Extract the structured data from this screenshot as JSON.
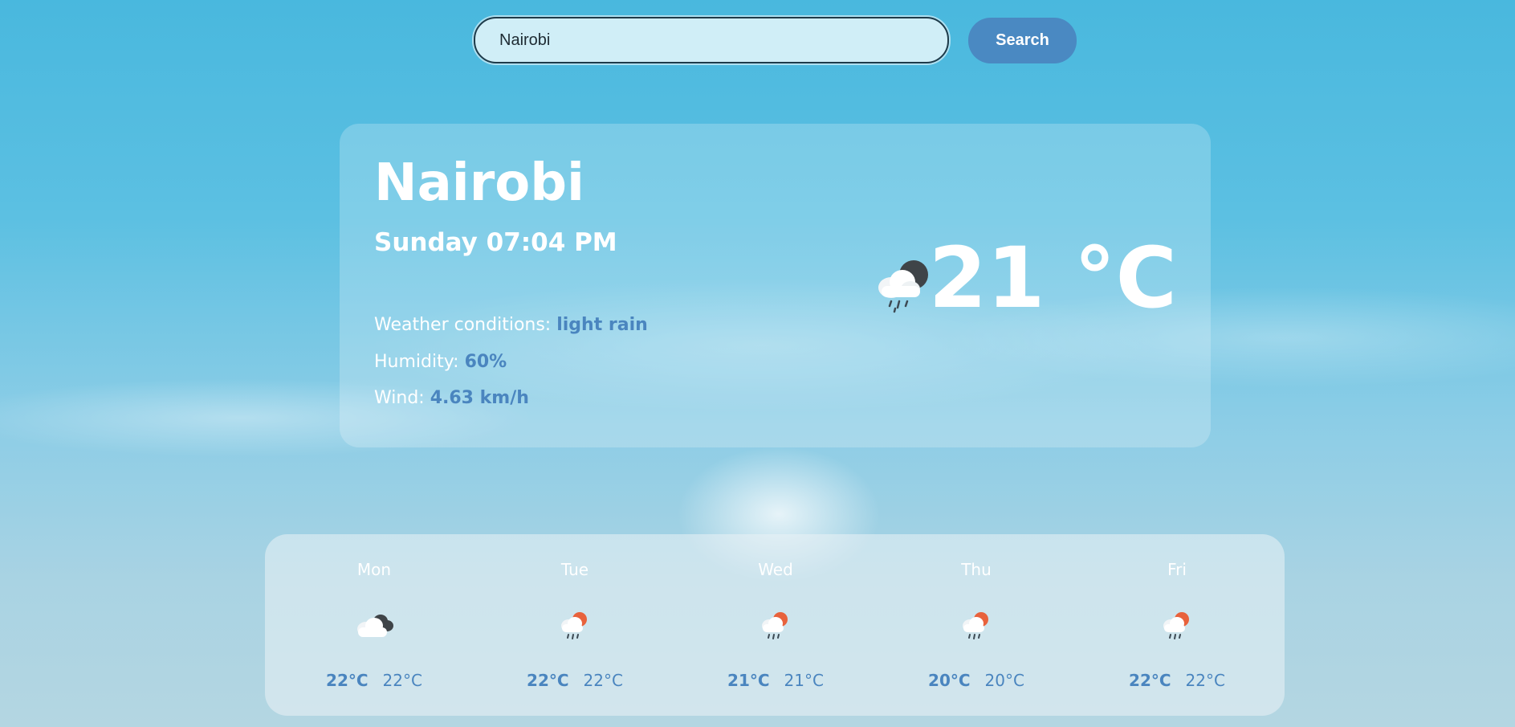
{
  "search": {
    "value": "Nairobi",
    "button_label": "Search"
  },
  "current": {
    "city": "Nairobi",
    "datetime": "Sunday 07:04 PM",
    "conditions_label": "Weather conditions: ",
    "conditions_value": "light rain",
    "humidity_label": "Humidity: ",
    "humidity_value": "60%",
    "wind_label": "Wind: ",
    "wind_value": "4.63 km/h",
    "temperature": "21 °C",
    "icon": "cloud-moon-rain-icon"
  },
  "forecast": [
    {
      "day": "Mon",
      "high": "22°C",
      "low": "22°C",
      "icon": "cloud-night-icon"
    },
    {
      "day": "Tue",
      "high": "22°C",
      "low": "22°C",
      "icon": "sun-cloud-rain-icon"
    },
    {
      "day": "Wed",
      "high": "21°C",
      "low": "21°C",
      "icon": "sun-cloud-rain-icon"
    },
    {
      "day": "Thu",
      "high": "20°C",
      "low": "20°C",
      "icon": "sun-cloud-rain-icon"
    },
    {
      "day": "Fri",
      "high": "22°C",
      "low": "22°C",
      "icon": "sun-cloud-rain-icon"
    }
  ],
  "colors": {
    "accent": "#4a85bf",
    "button": "#4a89c2"
  }
}
